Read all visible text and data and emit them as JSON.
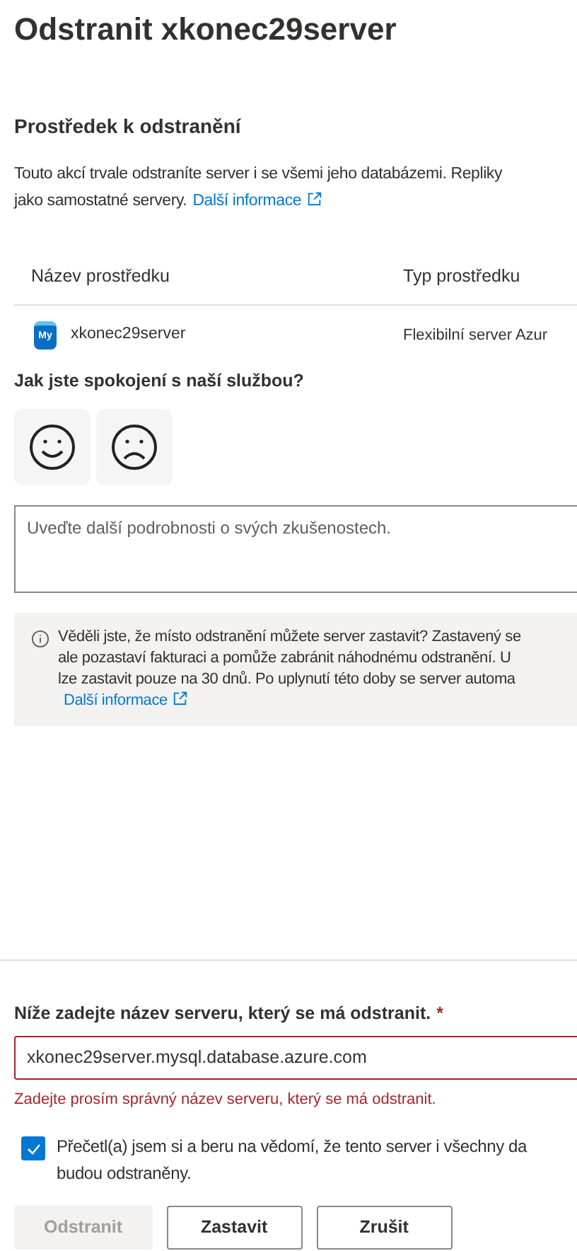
{
  "title": "Odstranit xkonec29server",
  "section": {
    "heading": "Prostředek k odstranění",
    "description_lines": [
      "Touto akcí trvale odstraníte server i se všemi jeho databázemi. Repliky",
      "jako samostatné servery."
    ],
    "link": "Další informace"
  },
  "table": {
    "columns": [
      "Název prostředku",
      "Typ prostředku"
    ],
    "rows": [
      {
        "name": "xkonec29server",
        "type": "Flexibilní server Azur",
        "icon_label": "My"
      }
    ]
  },
  "feedback": {
    "question": "Jak jste spokojení s naší službou?",
    "ratings": [
      {
        "kind": "happy",
        "selected": false
      },
      {
        "kind": "sad",
        "selected": false
      }
    ],
    "placeholder": "Uveďte další podrobnosti o svých zkušenostech."
  },
  "info": {
    "lines": [
      "Věděli jste, že místo odstranění můžete server zastavit? Zastavený se",
      "ale pozastaví fakturaci a pomůže zabránit náhodnému odstranění. U",
      "lze zastavit pouze na 30 dnů. Po uplynutí této doby se server automa"
    ],
    "link": "Další informace"
  },
  "confirm": {
    "label": "Níže zadejte název serveru, který se má odstranit.",
    "required_mark": "*",
    "value": "xkonec29server.mysql.database.azure.com",
    "error": "Zadejte prosím správný název serveru, který se má odstranit."
  },
  "acknowledge": {
    "checked": true,
    "lines": [
      "Přečetl(a) jsem si a beru na vědomí, že tento server i všechny da",
      "budou odstraněny."
    ]
  },
  "buttons": [
    {
      "label": "Odstranit",
      "disabled": true
    },
    {
      "label": "Zastavit",
      "disabled": false
    },
    {
      "label": "Zrušit",
      "disabled": false
    }
  ]
}
